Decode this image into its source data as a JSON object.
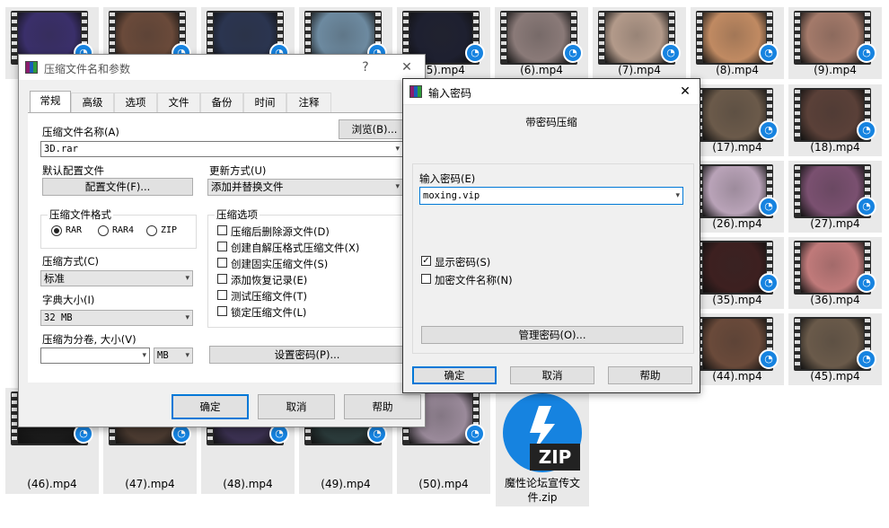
{
  "files": [
    {
      "name": "",
      "thumb": "#3a2f6a"
    },
    {
      "name": "",
      "thumb": "#6a4a3a"
    },
    {
      "name": "",
      "thumb": "#2b3550"
    },
    {
      "name": "",
      "thumb": "#6d8aa0"
    },
    {
      "name": "(5).mp4",
      "thumb": "#1e2030"
    },
    {
      "name": "(6).mp4",
      "thumb": "#8a7a78"
    },
    {
      "name": "(7).mp4",
      "thumb": "#b39a8a"
    },
    {
      "name": "(8).mp4",
      "thumb": "#c08a62"
    },
    {
      "name": "(9).mp4",
      "thumb": "#a47a6a"
    },
    {
      "name": "(17).mp4",
      "thumb": "#6b5a4a"
    },
    {
      "name": "(18).mp4",
      "thumb": "#5a4038"
    },
    {
      "name": "(26).mp4",
      "thumb": "#b9a3b8"
    },
    {
      "name": "(27).mp4",
      "thumb": "#7a5070"
    },
    {
      "name": "(35).mp4",
      "thumb": "#3d2020"
    },
    {
      "name": "(36).mp4",
      "thumb": "#c07a7a"
    },
    {
      "name": "(44).mp4",
      "thumb": "#6a4a3a"
    },
    {
      "name": "(45).mp4",
      "thumb": "#6a5a4a"
    },
    {
      "name": "(46).mp4",
      "thumb": "#1a1a1a"
    },
    {
      "name": "(47).mp4",
      "thumb": "#4a3a30"
    },
    {
      "name": "(48).mp4",
      "thumb": "#3a3050"
    },
    {
      "name": "(49).mp4",
      "thumb": "#2a3a3a"
    },
    {
      "name": "(50).mp4",
      "thumb": "#9a8a9a"
    }
  ],
  "zip_file": {
    "name": "魔性论坛宣传文件.zip",
    "icon_text": "ZIP"
  },
  "main_dialog": {
    "title": "压缩文件名和参数",
    "help_glyph": "?",
    "close_glyph": "✕",
    "tabs": [
      "常规",
      "高级",
      "选项",
      "文件",
      "备份",
      "时间",
      "注释"
    ],
    "archive_name_label": "压缩文件名称(A)",
    "browse_label": "浏览(B)...",
    "archive_name_value": "3D.rar",
    "default_profile_label": "默认配置文件",
    "profiles_button": "配置文件(F)...",
    "update_mode_label": "更新方式(U)",
    "update_mode_value": "添加并替换文件",
    "format_group": "压缩文件格式",
    "formats": [
      {
        "label": "RAR",
        "checked": true
      },
      {
        "label": "RAR4",
        "checked": false
      },
      {
        "label": "ZIP",
        "checked": false
      }
    ],
    "options_group": "压缩选项",
    "options": [
      {
        "label": "压缩后删除源文件(D)",
        "checked": false
      },
      {
        "label": "创建自解压格式压缩文件(X)",
        "checked": false
      },
      {
        "label": "创建固实压缩文件(S)",
        "checked": false
      },
      {
        "label": "添加恢复记录(E)",
        "checked": false
      },
      {
        "label": "测试压缩文件(T)",
        "checked": false
      },
      {
        "label": "锁定压缩文件(L)",
        "checked": false
      }
    ],
    "method_label": "压缩方式(C)",
    "method_value": "标准",
    "dict_label": "字典大小(I)",
    "dict_value": "32 MB",
    "split_label": "压缩为分卷, 大小(V)",
    "split_value": "",
    "split_unit": "MB",
    "set_password_button": "设置密码(P)...",
    "ok": "确定",
    "cancel": "取消",
    "help": "帮助"
  },
  "password_dialog": {
    "title": "输入密码",
    "close_glyph": "✕",
    "heading": "带密码压缩",
    "enter_label": "输入密码(E)",
    "password_value": "moxing.vip",
    "show_password_label": "显示密码(S)",
    "show_password_checked": true,
    "encrypt_names_label": "加密文件名称(N)",
    "encrypt_names_checked": false,
    "organize_button": "管理密码(O)...",
    "ok": "确定",
    "cancel": "取消",
    "help": "帮助"
  }
}
